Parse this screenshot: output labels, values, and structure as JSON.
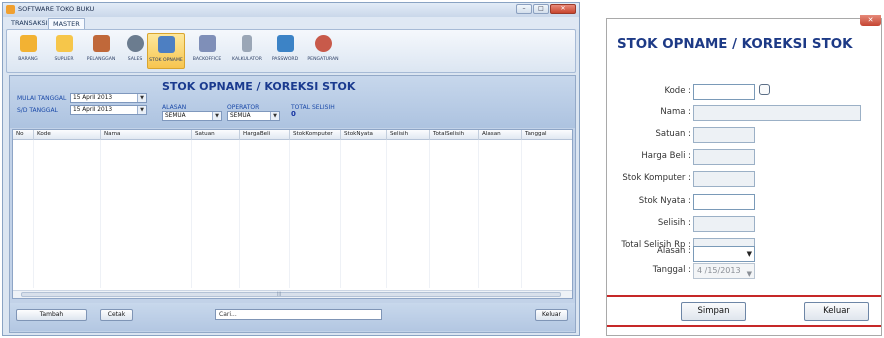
{
  "window": {
    "title": "SOFTWARE TOKO BUKU",
    "controls": [
      "minimize",
      "maximize",
      "close"
    ]
  },
  "menu": {
    "tabs": [
      "TRANSAKSI",
      "MASTER"
    ],
    "active_tab": "MASTER"
  },
  "ribbon": {
    "items": [
      {
        "label": "BARANG",
        "icon": "box-icon",
        "color": "#f2b233"
      },
      {
        "label": "SUPLIER",
        "icon": "folder-icon",
        "color": "#f6c64a"
      },
      {
        "label": "PELANGGAN",
        "icon": "book-icon",
        "color": "#c0683a"
      },
      {
        "label": "SALES",
        "icon": "user-icon",
        "color": "#6b7c8f"
      },
      {
        "label": "STOK OPNAME",
        "icon": "chart-icon",
        "color": "#4d7fc2"
      },
      {
        "label": "BACKOFFICE",
        "icon": "office-icon",
        "color": "#7f8fb8"
      },
      {
        "label": "KALKULATOR",
        "icon": "calculator-icon",
        "color": "#9aa6b6"
      },
      {
        "label": "PASSWORD",
        "icon": "password-icon",
        "color": "#3c83c6"
      },
      {
        "label": "PENGATURAN",
        "icon": "settings-icon",
        "color": "#c85a4a"
      }
    ],
    "active": "STOK OPNAME"
  },
  "filter": {
    "mulai_label": "MULAI TANGGAL",
    "mulai_value": "15 April 2013",
    "sd_label": "S/D TANGGAL",
    "sd_value": "15 April 2013",
    "alasan_label": "ALASAN",
    "alasan_value": "SEMUA",
    "operator_label": "OPERATOR",
    "operator_value": "SEMUA",
    "total_label": "TOTAL SELISIH",
    "total_value": "0"
  },
  "main": {
    "title": "STOK OPNAME / KOREKSI STOK"
  },
  "grid": {
    "columns": [
      "No",
      "Kode",
      "Nama",
      "Satuan",
      "HargaBeli",
      "StokKomputer",
      "StokNyata",
      "Selisih",
      "TotalSelisih",
      "Alasan",
      "Tanggal"
    ],
    "rows": []
  },
  "bottom": {
    "tambah_label": "Tambah",
    "cetak_label": "Cetak",
    "search_placeholder": "Cari...",
    "keluar_label": "Keluar"
  },
  "dialog": {
    "title": "STOK OPNAME / KOREKSI STOK",
    "fields": {
      "kode_label": "Kode :",
      "nama_label": "Nama :",
      "satuan_label": "Satuan :",
      "harga_label": "Harga Beli :",
      "stok_komputer_label": "Stok Komputer :",
      "stok_nyata_label": "Stok Nyata :",
      "selisih_label": "Selisih :",
      "total_selisih_label": "Total Selisih Rp :",
      "alasan_label": "Alasan :",
      "tanggal_label": "Tanggal :",
      "tanggal_value": "4 /15/2013"
    },
    "simpan_label": "Simpan",
    "keluar_label": "Keluar",
    "accent_color": "#c62828"
  }
}
